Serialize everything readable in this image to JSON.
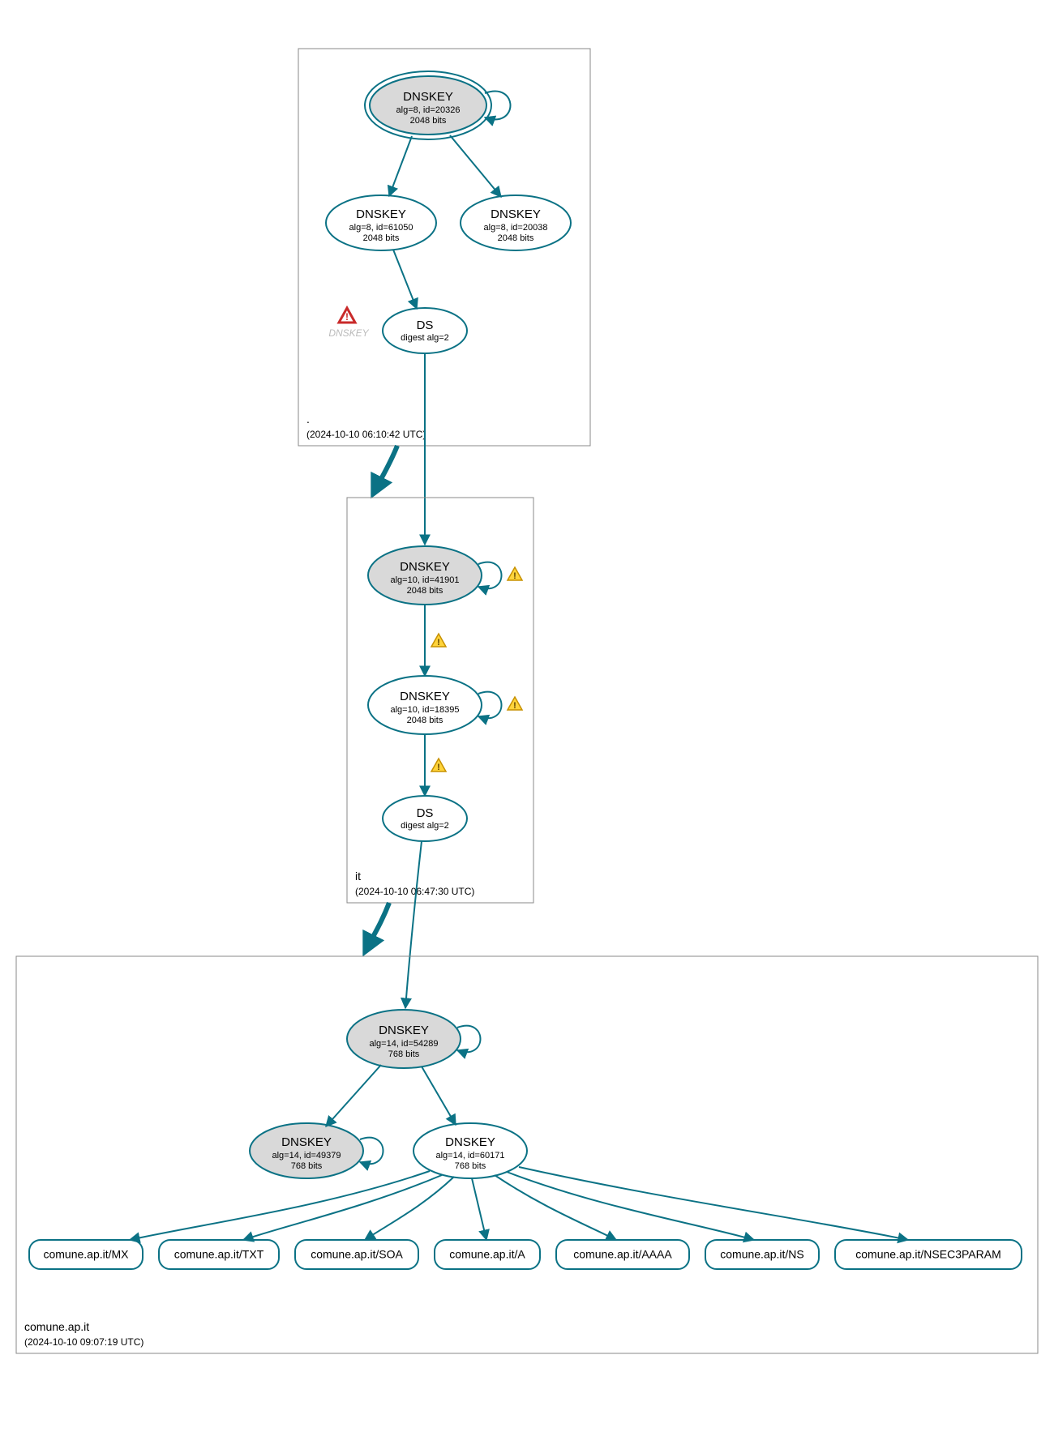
{
  "colors": {
    "edge": "#0b7285",
    "nodeFill": "#d9d9d9",
    "warnYellow": "#ffd43b",
    "warnRed": "#c92a2a"
  },
  "zones": {
    "root": {
      "label": ".",
      "timestamp": "(2024-10-10 06:10:42 UTC)",
      "nodes": {
        "ksk": {
          "title": "DNSKEY",
          "line1": "alg=8, id=20326",
          "line2": "2048 bits"
        },
        "zsk1": {
          "title": "DNSKEY",
          "line1": "alg=8, id=61050",
          "line2": "2048 bits"
        },
        "zsk2": {
          "title": "DNSKEY",
          "line1": "alg=8, id=20038",
          "line2": "2048 bits"
        },
        "ds": {
          "title": "DS",
          "line1": "digest alg=2"
        },
        "ghost": "DNSKEY"
      }
    },
    "it": {
      "label": "it",
      "timestamp": "(2024-10-10 06:47:30 UTC)",
      "nodes": {
        "ksk": {
          "title": "DNSKEY",
          "line1": "alg=10, id=41901",
          "line2": "2048 bits"
        },
        "zsk": {
          "title": "DNSKEY",
          "line1": "alg=10, id=18395",
          "line2": "2048 bits"
        },
        "ds": {
          "title": "DS",
          "line1": "digest alg=2"
        }
      }
    },
    "comune": {
      "label": "comune.ap.it",
      "timestamp": "(2024-10-10 09:07:19 UTC)",
      "nodes": {
        "ksk": {
          "title": "DNSKEY",
          "line1": "alg=14, id=54289",
          "line2": "768 bits"
        },
        "zsk1": {
          "title": "DNSKEY",
          "line1": "alg=14, id=49379",
          "line2": "768 bits"
        },
        "zsk2": {
          "title": "DNSKEY",
          "line1": "alg=14, id=60171",
          "line2": "768 bits"
        }
      },
      "rrsets": [
        "comune.ap.it/MX",
        "comune.ap.it/TXT",
        "comune.ap.it/SOA",
        "comune.ap.it/A",
        "comune.ap.it/AAAA",
        "comune.ap.it/NS",
        "comune.ap.it/NSEC3PARAM"
      ]
    }
  }
}
